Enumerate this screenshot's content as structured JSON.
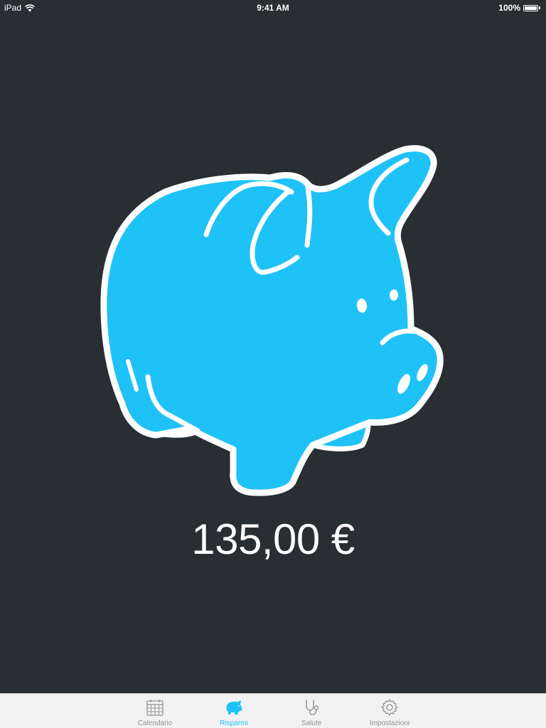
{
  "status_bar": {
    "device": "iPad",
    "time": "9:41 AM",
    "battery": "100%",
    "battery_level": 1.0
  },
  "main": {
    "amount": "135,00 €"
  },
  "tab_bar": {
    "tabs": [
      {
        "label": "Calendario",
        "icon": "calendar-icon",
        "active": false
      },
      {
        "label": "Risparmi",
        "icon": "piggy-bank-icon",
        "active": true
      },
      {
        "label": "Salute",
        "icon": "stethoscope-icon",
        "active": false
      },
      {
        "label": "Impostazioni",
        "icon": "gear-icon",
        "active": false
      }
    ]
  },
  "colors": {
    "background": "#292e32",
    "accent": "#1fc2f7",
    "tab_inactive": "#929292",
    "tab_bar_background": "#f2f2f3"
  }
}
